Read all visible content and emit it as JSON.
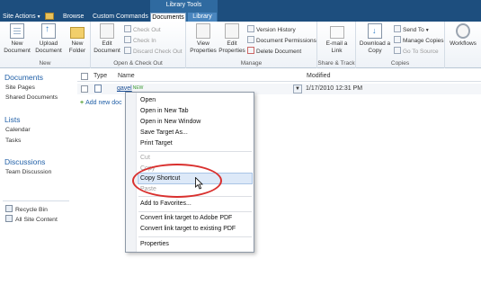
{
  "topbar": {
    "site_actions": "Site Actions",
    "browse": "Browse",
    "custom_commands": "Custom Commands",
    "contextual_group": "Library Tools",
    "tab_documents": "Documents",
    "tab_library": "Library"
  },
  "ribbon": {
    "new_group": {
      "label": "New",
      "new_document": "New Document",
      "upload_document": "Upload Document",
      "new_folder": "New Folder"
    },
    "open_checkout_group": {
      "label": "Open & Check Out",
      "edit_document": "Edit Document",
      "check_out": "Check Out",
      "check_in": "Check In",
      "discard_check_out": "Discard Check Out"
    },
    "manage_group": {
      "label": "Manage",
      "view_properties": "View Properties",
      "edit_properties": "Edit Properties",
      "version_history": "Version History",
      "document_permissions": "Document Permissions",
      "delete_document": "Delete Document"
    },
    "share_track_group": {
      "label": "Share & Track",
      "email_link": "E-mail a Link"
    },
    "copies_group": {
      "label": "Copies",
      "download_copy": "Download a Copy",
      "send_to": "Send To",
      "manage_copies": "Manage Copies",
      "go_to_source": "Go To Source"
    },
    "workflows": "Workflows"
  },
  "quicklaunch": {
    "documents_head": "Documents",
    "site_pages": "Site Pages",
    "shared_documents": "Shared Documents",
    "lists_head": "Lists",
    "calendar": "Calendar",
    "tasks": "Tasks",
    "discussions_head": "Discussions",
    "team_discussion": "Team Discussion",
    "recycle_bin": "Recycle Bin",
    "all_site_content": "All Site Content"
  },
  "list": {
    "col_type": "Type",
    "col_name": "Name",
    "col_modified": "Modified",
    "row_name": "gavel",
    "row_new_badge": "NEW",
    "row_modified": "1/17/2010 12:31 PM",
    "add_new": "Add new doc"
  },
  "context_menu": {
    "items": [
      "Open",
      "Open in New Tab",
      "Open in New Window",
      "Save Target As...",
      "Print Target",
      "Cut",
      "Copy",
      "Copy Shortcut",
      "Paste",
      "Add to Favorites...",
      "Convert link target to Adobe PDF",
      "Convert link target to existing PDF",
      "Properties"
    ],
    "disabled": [
      "Cut",
      "Copy",
      "Paste"
    ],
    "highlighted": "Copy Shortcut"
  },
  "colors": {
    "topbar": "#1d4e7e",
    "link_blue": "#2261a8",
    "annotation_red": "#d9302e"
  }
}
